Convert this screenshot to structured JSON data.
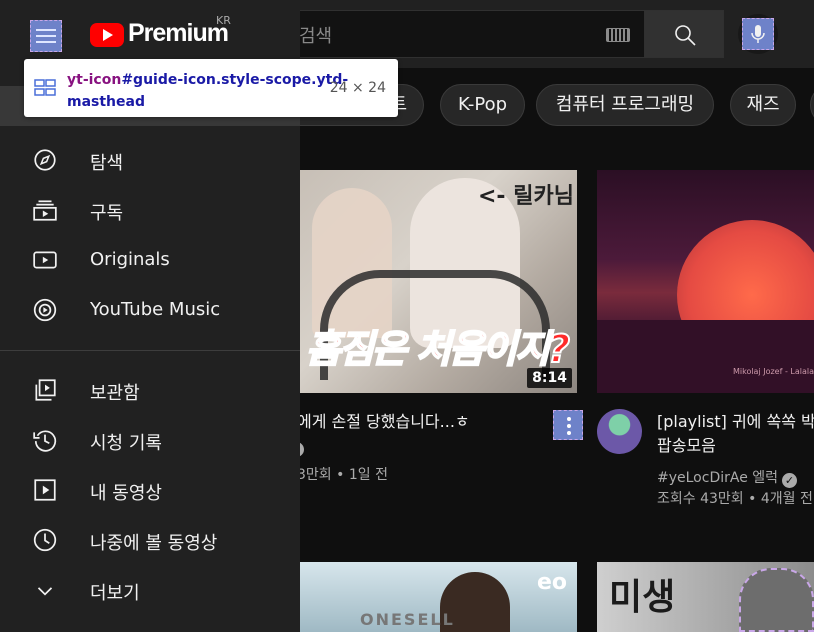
{
  "masthead": {
    "logo_text": "Premium",
    "region": "KR",
    "search_placeholder": "검색"
  },
  "tooltip": {
    "tag": "yt-icon",
    "selector": "#guide-icon.style-scope.ytd-masthead",
    "size": "24 × 24"
  },
  "chips": [
    {
      "label": "트"
    },
    {
      "label": "K-Pop"
    },
    {
      "label": "컴퓨터 프로그래밍"
    },
    {
      "label": "재즈"
    }
  ],
  "sidebar": {
    "section1": [
      {
        "label": "탐색",
        "icon": "compass-icon"
      },
      {
        "label": "구독",
        "icon": "subscriptions-icon"
      },
      {
        "label": "Originals",
        "icon": "originals-icon"
      },
      {
        "label": "YouTube Music",
        "icon": "music-icon"
      }
    ],
    "section2": [
      {
        "label": "보관함",
        "icon": "library-icon"
      },
      {
        "label": "시청 기록",
        "icon": "history-icon"
      },
      {
        "label": "내 동영상",
        "icon": "my-videos-icon"
      },
      {
        "label": "나중에 볼 동영상",
        "icon": "watch-later-icon"
      },
      {
        "label": "더보기",
        "icon": "chevron-down-icon"
      }
    ]
  },
  "videos": [
    {
      "thumb_tag": "<- 릴카님",
      "thumb_caption": "홈짐은 처음이지?",
      "duration": "8:14",
      "title": "에게 손절 당했습니다...ㅎ",
      "meta": "3만회 • 1일 전"
    },
    {
      "thumb_credit": "Mikolaj Jozef - Lalala",
      "title_line1": "[playlist] 귀에 쏙쏙 박",
      "title_line2": "팝송모음",
      "channel": "#yeLocDirAe 엘럭",
      "meta": "조회수 43만회 • 4개월 전"
    },
    {
      "thumb_brand": "ONESELL",
      "thumb_logo": "eo"
    },
    {
      "thumb_word": "미생"
    }
  ],
  "colors": {
    "background": "#0f0f0f",
    "sidebar": "#212121",
    "highlight": "#6e82c9",
    "brand_red": "#ff0000"
  }
}
